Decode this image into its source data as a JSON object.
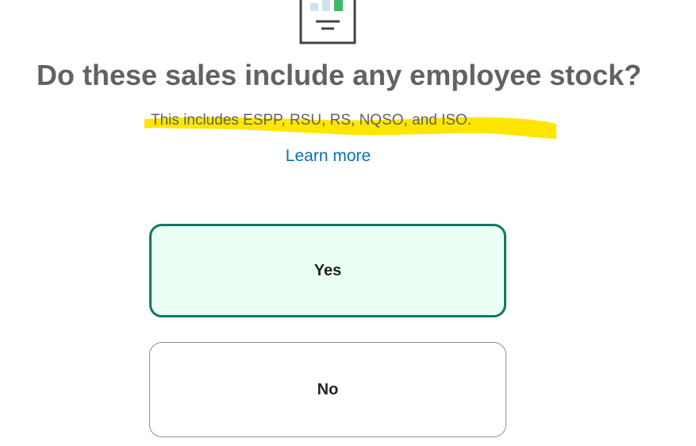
{
  "question": {
    "title": "Do these sales include any employee stock?",
    "subtitle": "This includes ESPP, RSU, RS, NQSO, and ISO.",
    "learn_more": "Learn more"
  },
  "choices": {
    "yes_label": "Yes",
    "no_label": "No"
  },
  "icon": {
    "name": "document-chart-icon"
  },
  "colors": {
    "title_text": "#5f6366",
    "highlight": "#ffe600",
    "link": "#0a6fb5",
    "selected_border": "#0a7a62",
    "selected_bg": "#ebfff5",
    "unselected_border": "#8c9296",
    "chart_bar_green": "#3dbb6a",
    "chart_bar_light": "#cfe3ef"
  }
}
